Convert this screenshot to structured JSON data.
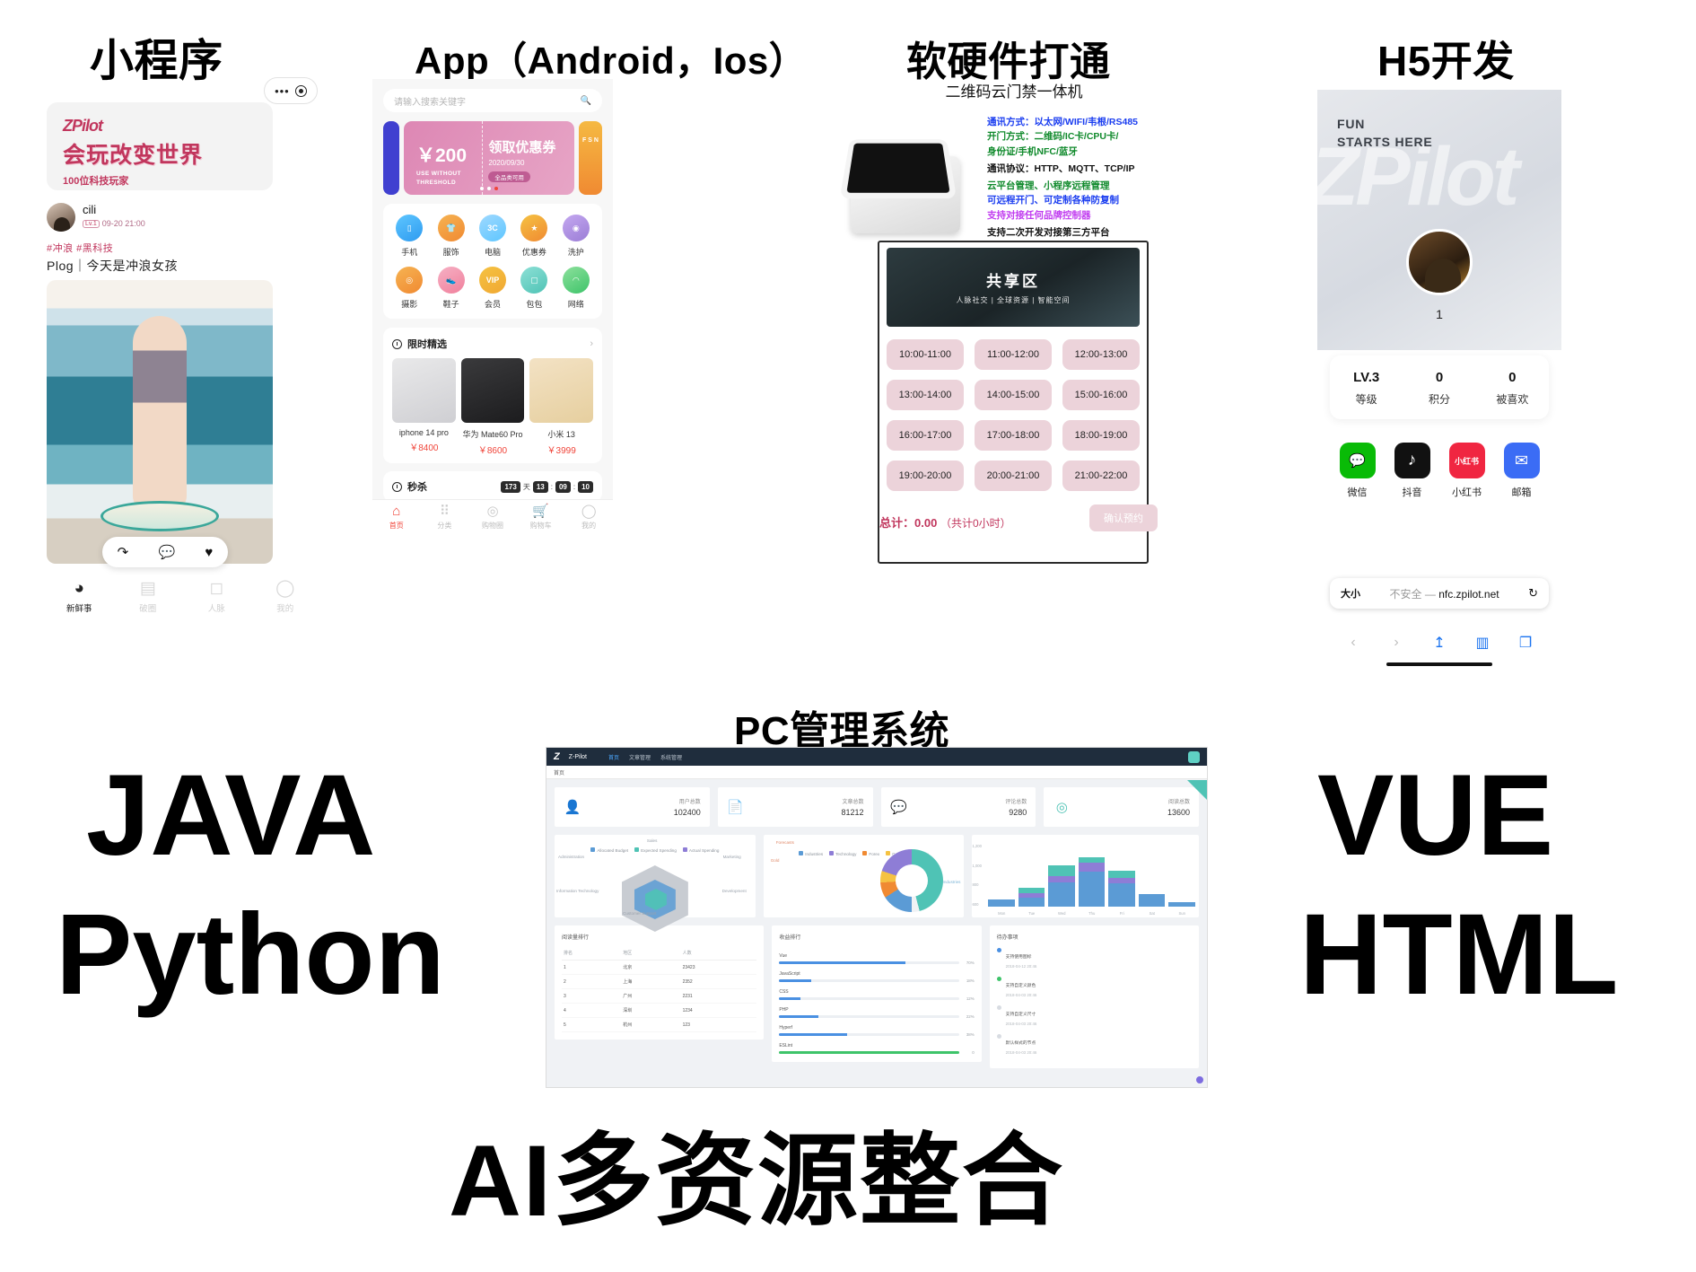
{
  "sections": {
    "mini_title": "小程序",
    "app_title": "App（Android，Ios）",
    "hardware_title": "软硬件打通",
    "h5_title": "H5开发",
    "pc_title": "PC管理系统"
  },
  "bigwords": {
    "java": "JAVA",
    "python": "Python",
    "vue": "VUE",
    "html": "HTML",
    "ai": "AI多资源整合"
  },
  "mini": {
    "capsule_dots": "•••",
    "banner": {
      "logo": "ZPilot",
      "headline": "会玩改变世界",
      "subline": "100位科技玩家"
    },
    "user": {
      "name": "cili",
      "level": "Lv.1",
      "time": "09-20 21:00"
    },
    "tags": "#冲浪  #黑科技",
    "post_title": "Plog｜今天是冲浪女孩",
    "actions": {
      "share": "↷",
      "comment": "💬",
      "like": "♥"
    },
    "tabs": [
      {
        "label": "新鲜事",
        "icon": "chat-icon",
        "glyph": "◕",
        "active": true
      },
      {
        "label": "破圈",
        "icon": "calendar-icon",
        "glyph": "▤",
        "active": false
      },
      {
        "label": "人脉",
        "icon": "pulse-icon",
        "glyph": "◻",
        "active": false
      },
      {
        "label": "我的",
        "icon": "profile-icon",
        "glyph": "◯",
        "active": false
      }
    ]
  },
  "app": {
    "search_placeholder": "请输入搜索关键字",
    "search_icon": "🔍",
    "banner": {
      "amount": "￥200",
      "sub": "USE WITHOUT\nTHRESHOLD",
      "title": "领取优惠券",
      "date": "2020/09/30",
      "pill": "全品类可用",
      "side": "F S N"
    },
    "grid": [
      {
        "label": "手机",
        "glyph": "▯",
        "color1": "#2e9bf0",
        "color2": "#5ec6ff"
      },
      {
        "label": "服饰",
        "glyph": "👕",
        "color1": "#f6b352",
        "color2": "#f08a32"
      },
      {
        "label": "电脑",
        "glyph": "3C",
        "color1": "#5ec6ff",
        "color2": "#9fd9ff"
      },
      {
        "label": "优惠券",
        "glyph": "★",
        "color1": "#f5c242",
        "color2": "#f08a32"
      },
      {
        "label": "洗护",
        "glyph": "◉",
        "color1": "#9b7dd6",
        "color2": "#c4a8f0"
      },
      {
        "label": "摄影",
        "glyph": "◎",
        "color1": "#f6b352",
        "color2": "#f08a32"
      },
      {
        "label": "鞋子",
        "glyph": "👟",
        "color1": "#f0809c",
        "color2": "#f6b0c4"
      },
      {
        "label": "会员",
        "glyph": "VIP",
        "color1": "#f5c242",
        "color2": "#f0a832"
      },
      {
        "label": "包包",
        "glyph": "▢",
        "color1": "#4fc3b5",
        "color2": "#8de0d6"
      },
      {
        "label": "网络",
        "glyph": "◠",
        "color1": "#3ec46a",
        "color2": "#8de09c"
      }
    ],
    "featured": {
      "title": "限时精选",
      "arrow": "›",
      "products": [
        {
          "name": "iphone 14 pro",
          "price": "￥8400"
        },
        {
          "name": "华为 Mate60 Pro",
          "price": "￥8600"
        },
        {
          "name": "小米 13",
          "price": "￥3999"
        }
      ]
    },
    "seckill": {
      "title": "秒杀",
      "days_value": "173",
      "days_label": "天",
      "hours": "13",
      "minutes": "09",
      "seconds": "10"
    },
    "tabs": [
      {
        "label": "首页",
        "glyph": "⌂",
        "active": true
      },
      {
        "label": "分类",
        "glyph": "⠿",
        "active": false
      },
      {
        "label": "购物圈",
        "glyph": "◎",
        "active": false
      },
      {
        "label": "购物车",
        "glyph": "🛒",
        "active": false
      },
      {
        "label": "我的",
        "glyph": "◯",
        "active": false
      }
    ]
  },
  "hardware": {
    "subtitle": "二维码云门禁一体机",
    "specs": [
      {
        "text": "通讯方式：以太网/WIFI/韦根/RS485",
        "color": "#1a3df0"
      },
      {
        "text": "开门方式：二维码/IC卡/CPU卡/",
        "color": "#108a2c"
      },
      {
        "text": "身份证/手机NFC/蓝牙",
        "color": "#108a2c"
      },
      {
        "text": "通讯协议：HTTP、MQTT、TCP/IP",
        "color": "#111111"
      },
      {
        "text": "云平台管理、小程序远程管理",
        "color": "#108a2c"
      },
      {
        "text": "可远程开门、可定制各种防复制",
        "color": "#1a3df0"
      },
      {
        "text": "支持对接任何品牌控制器",
        "color": "#c13df0"
      },
      {
        "text": "支持二次开发对接第三方平台",
        "color": "#111111"
      }
    ],
    "photo": {
      "title": "共享区",
      "sub": "人脉社交 | 全球资源 | 智能空间"
    },
    "slots": [
      "10:00-11:00",
      "11:00-12:00",
      "12:00-13:00",
      "13:00-14:00",
      "14:00-15:00",
      "15:00-16:00",
      "16:00-17:00",
      "17:00-18:00",
      "18:00-19:00",
      "19:00-20:00",
      "20:00-21:00",
      "21:00-22:00"
    ],
    "total_label": "总计：0.00",
    "total_hours": "（共计0小时）",
    "confirm_label": "确认预约"
  },
  "h5": {
    "hero": {
      "fun_line1": "FUN",
      "fun_line2": "STARTS HERE",
      "watermark": "ZPilot"
    },
    "username": "1",
    "stats": [
      {
        "value": "LV.3",
        "label": "等级"
      },
      {
        "value": "0",
        "label": "积分"
      },
      {
        "value": "0",
        "label": "被喜欢"
      }
    ],
    "socials": [
      {
        "label": "微信",
        "glyph": "💬",
        "bg": "#09bb07",
        "icon": "wechat-icon"
      },
      {
        "label": "抖音",
        "glyph": "♪",
        "bg": "#111111",
        "icon": "douyin-icon"
      },
      {
        "label": "小红书",
        "glyph": "小红书",
        "bg": "#f02641",
        "icon": "xiaohongshu-icon"
      },
      {
        "label": "邮箱",
        "glyph": "✉",
        "bg": "#3b6cf5",
        "icon": "mail-icon"
      }
    ],
    "browser": {
      "size_label": "大小",
      "insecure": "不安全",
      "separator": "—",
      "url": "nfc.zpilot.net",
      "reload": "↻",
      "back": "‹",
      "forward": "›",
      "share": "↥",
      "bookmarks": "▥",
      "tabs": "❐"
    }
  },
  "pc": {
    "brand_logo": "Z",
    "brand_name": "Z-Pilot",
    "nav": [
      {
        "label": "首页",
        "active": true
      },
      {
        "label": "文章管理",
        "active": false
      },
      {
        "label": "系统管理",
        "active": false
      }
    ],
    "breadcrumb": "首页",
    "stats": [
      {
        "icon": "user-icon",
        "glyph": "👤",
        "color": "#4fc3b5",
        "label": "用户总数",
        "value": "102400"
      },
      {
        "icon": "doc-icon",
        "glyph": "📄",
        "color": "#4a90e2",
        "label": "文章总数",
        "value": "81212"
      },
      {
        "icon": "comment-icon",
        "glyph": "💬",
        "color": "#f0453a",
        "label": "评论总数",
        "value": "9280"
      },
      {
        "icon": "eye-icon",
        "glyph": "◎",
        "color": "#4fc3b5",
        "label": "阅读总数",
        "value": "13600"
      }
    ],
    "radar": {
      "title": "",
      "axis_labels": [
        "Sales",
        "Marketing",
        "Development",
        "Customer Support",
        "Information Technology",
        "Administration"
      ],
      "legend": [
        {
          "name": "Allocated Budget",
          "color": "#5b9bd5"
        },
        {
          "name": "Expected Spending",
          "color": "#4fc3b5"
        },
        {
          "name": "Actual Spending",
          "color": "#8e7dd6"
        }
      ]
    },
    "pie": {
      "labels": [
        "Forecasts",
        "Gold",
        "Industries",
        "Technology",
        "Forex",
        "Gold",
        "Tentacle"
      ],
      "legend": [
        {
          "name": "Industries",
          "color": "#5b9bd5"
        },
        {
          "name": "Technology",
          "color": "#8e7dd6"
        },
        {
          "name": "Forex",
          "color": "#f08a32"
        },
        {
          "name": "Gold",
          "color": "#f5c242"
        },
        {
          "name": "Tentacle",
          "color": "#4fc3b5"
        }
      ]
    },
    "bar_chart": {
      "y_ticks": [
        "1,200",
        "1,000",
        "800",
        "600",
        "400",
        "200",
        "0"
      ],
      "x_labels": [
        "Mon",
        "Tue",
        "Wed",
        "Thu",
        "Fri",
        "Sat",
        "Sun"
      ]
    },
    "reading_rank": {
      "title": "阅读量排行",
      "columns": [
        "排名",
        "地区",
        "人数"
      ],
      "rows": [
        [
          "1",
          "北京",
          "23423"
        ],
        [
          "2",
          "上海",
          "2352"
        ],
        [
          "3",
          "广州",
          "2231"
        ],
        [
          "4",
          "深圳",
          "1234"
        ],
        [
          "5",
          "杭州",
          "123"
        ]
      ]
    },
    "income_rank": {
      "title": "收益排行",
      "items": [
        {
          "name": "Vue",
          "pct": "70%",
          "value": 70,
          "color": "#4a90e2"
        },
        {
          "name": "JavaScript",
          "pct": "18%",
          "value": 18,
          "color": "#4a90e2"
        },
        {
          "name": "CSS",
          "pct": "12%",
          "value": 12,
          "color": "#4a90e2"
        },
        {
          "name": "PHP",
          "pct": "22%",
          "value": 22,
          "color": "#4a90e2"
        },
        {
          "name": "Hyperf",
          "pct": "38%",
          "value": 38,
          "color": "#4a90e2"
        },
        {
          "name": "ESLint",
          "pct": "0",
          "value": 100,
          "color": "#3ec46a"
        }
      ]
    },
    "todo": {
      "title": "待办事项",
      "items": [
        {
          "text": "支持使用图标",
          "date": "2018-04-12 20:46",
          "color": "#4a90e2"
        },
        {
          "text": "支持自定义颜色",
          "date": "2018-04-03 20:46",
          "color": "#3ec46a"
        },
        {
          "text": "支持自定义尺寸",
          "date": "2018-04-03 20:46",
          "color": "#d8dce2"
        },
        {
          "text": "默认样式的节点",
          "date": "2018-04-03 20:46",
          "color": "#d8dce2"
        }
      ]
    }
  }
}
